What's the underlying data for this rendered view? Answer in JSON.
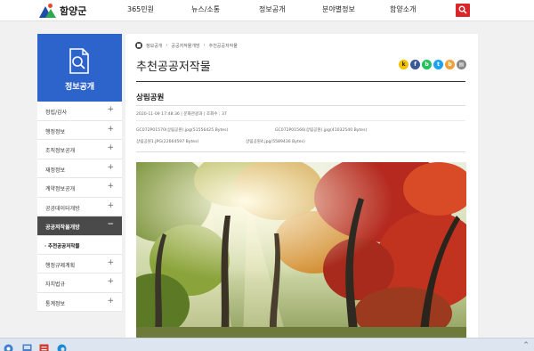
{
  "header": {
    "logo_text": "함양군",
    "nav": [
      "365민원",
      "뉴스/소통",
      "정보공개",
      "분야별정보",
      "함양소개"
    ]
  },
  "sidebar": {
    "title": "정보공개",
    "items": [
      {
        "label": "정립/감사",
        "toggle": "+"
      },
      {
        "label": "행정정보",
        "toggle": "+"
      },
      {
        "label": "조직정보공개",
        "toggle": "+"
      },
      {
        "label": "재정정보",
        "toggle": "+"
      },
      {
        "label": "계약정보공개",
        "toggle": "+"
      },
      {
        "label": "공공데이터개방",
        "toggle": "+"
      },
      {
        "label": "공공저작물개방",
        "toggle": "−"
      },
      {
        "label": "행정규제계획",
        "toggle": "+"
      },
      {
        "label": "자치법규",
        "toggle": "+"
      },
      {
        "label": "통계정보",
        "toggle": "+"
      }
    ],
    "active_sub": "· 추천공공저작물"
  },
  "content": {
    "breadcrumb": [
      "정보공개",
      "공공저작물개방",
      "추천공공저작물"
    ],
    "page_title": "추천공공저작물",
    "share_icons": [
      "kakao-story-icon",
      "facebook-icon",
      "band-icon",
      "twitter-icon",
      "blog-icon",
      "print-icon"
    ],
    "post_title": "상림공원",
    "meta": "2020-11-09 17:48:36  |  문화관광과  |  조회수 : 37",
    "attachments": [
      "GC072P01570(상림공원).jpg(51556425 Bytes)",
      "GC072P01566(상림공원).jpg(41032540 Bytes)",
      "상림공원1.JPG(22664597 Bytes)",
      "상림공원4.jpg(5589436 Bytes)"
    ]
  },
  "taskbar": {
    "tray_text": "^"
  },
  "colors": {
    "brand_blue": "#2d64cb",
    "search_red": "#d9262a",
    "active_gray": "#4a4a4a"
  }
}
